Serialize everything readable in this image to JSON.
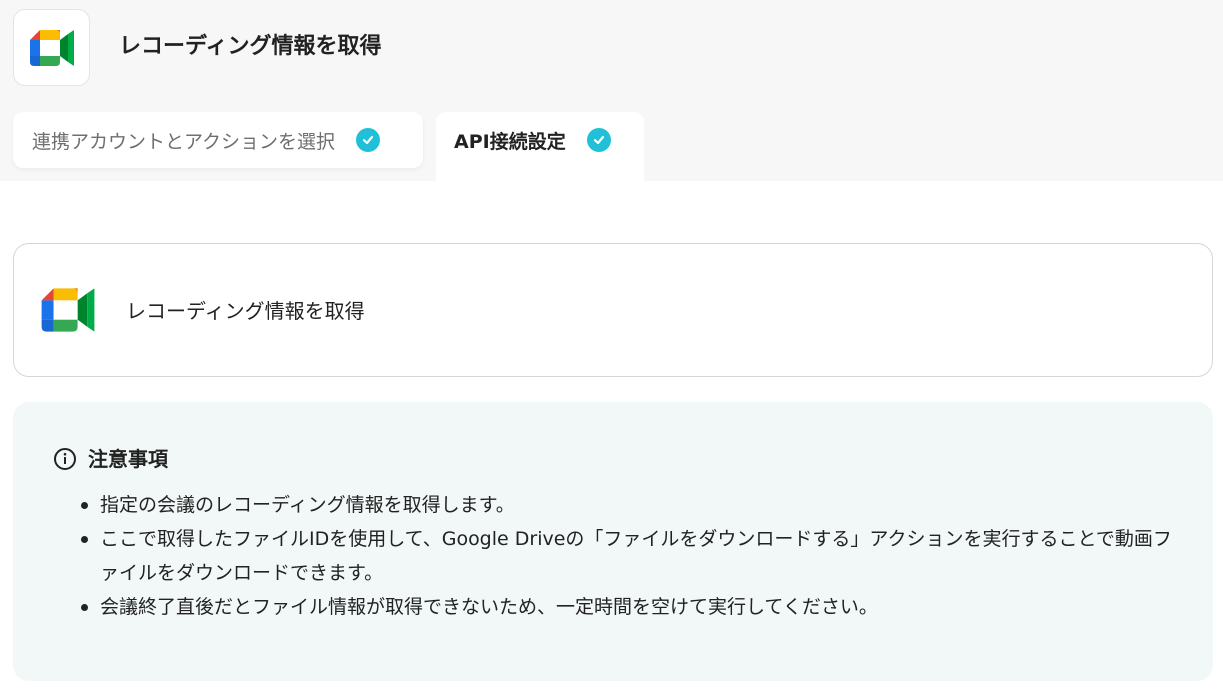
{
  "header": {
    "title": "レコーディング情報を取得",
    "app_icon": "google-meet-icon"
  },
  "tabs": [
    {
      "label": "連携アカウントとアクションを選択",
      "completed": true,
      "active": false
    },
    {
      "label": "API接続設定",
      "completed": true,
      "active": true
    }
  ],
  "action_card": {
    "label": "レコーディング情報を取得",
    "icon": "google-meet-icon"
  },
  "notice": {
    "icon": "info-icon",
    "title": "注意事項",
    "items": [
      "指定の会議のレコーディング情報を取得します。",
      "ここで取得したファイルIDを使用して、Google Driveの「ファイルをダウンロードする」アクションを実行することで動画ファイルをダウンロードできます。",
      "会議終了直後だとファイル情報が取得できないため、一定時間を空けて実行してください。"
    ]
  },
  "colors": {
    "check_badge": "#1fc0d8",
    "notice_bg": "#f1f8f7",
    "topbar_bg": "#f7f7f7"
  }
}
